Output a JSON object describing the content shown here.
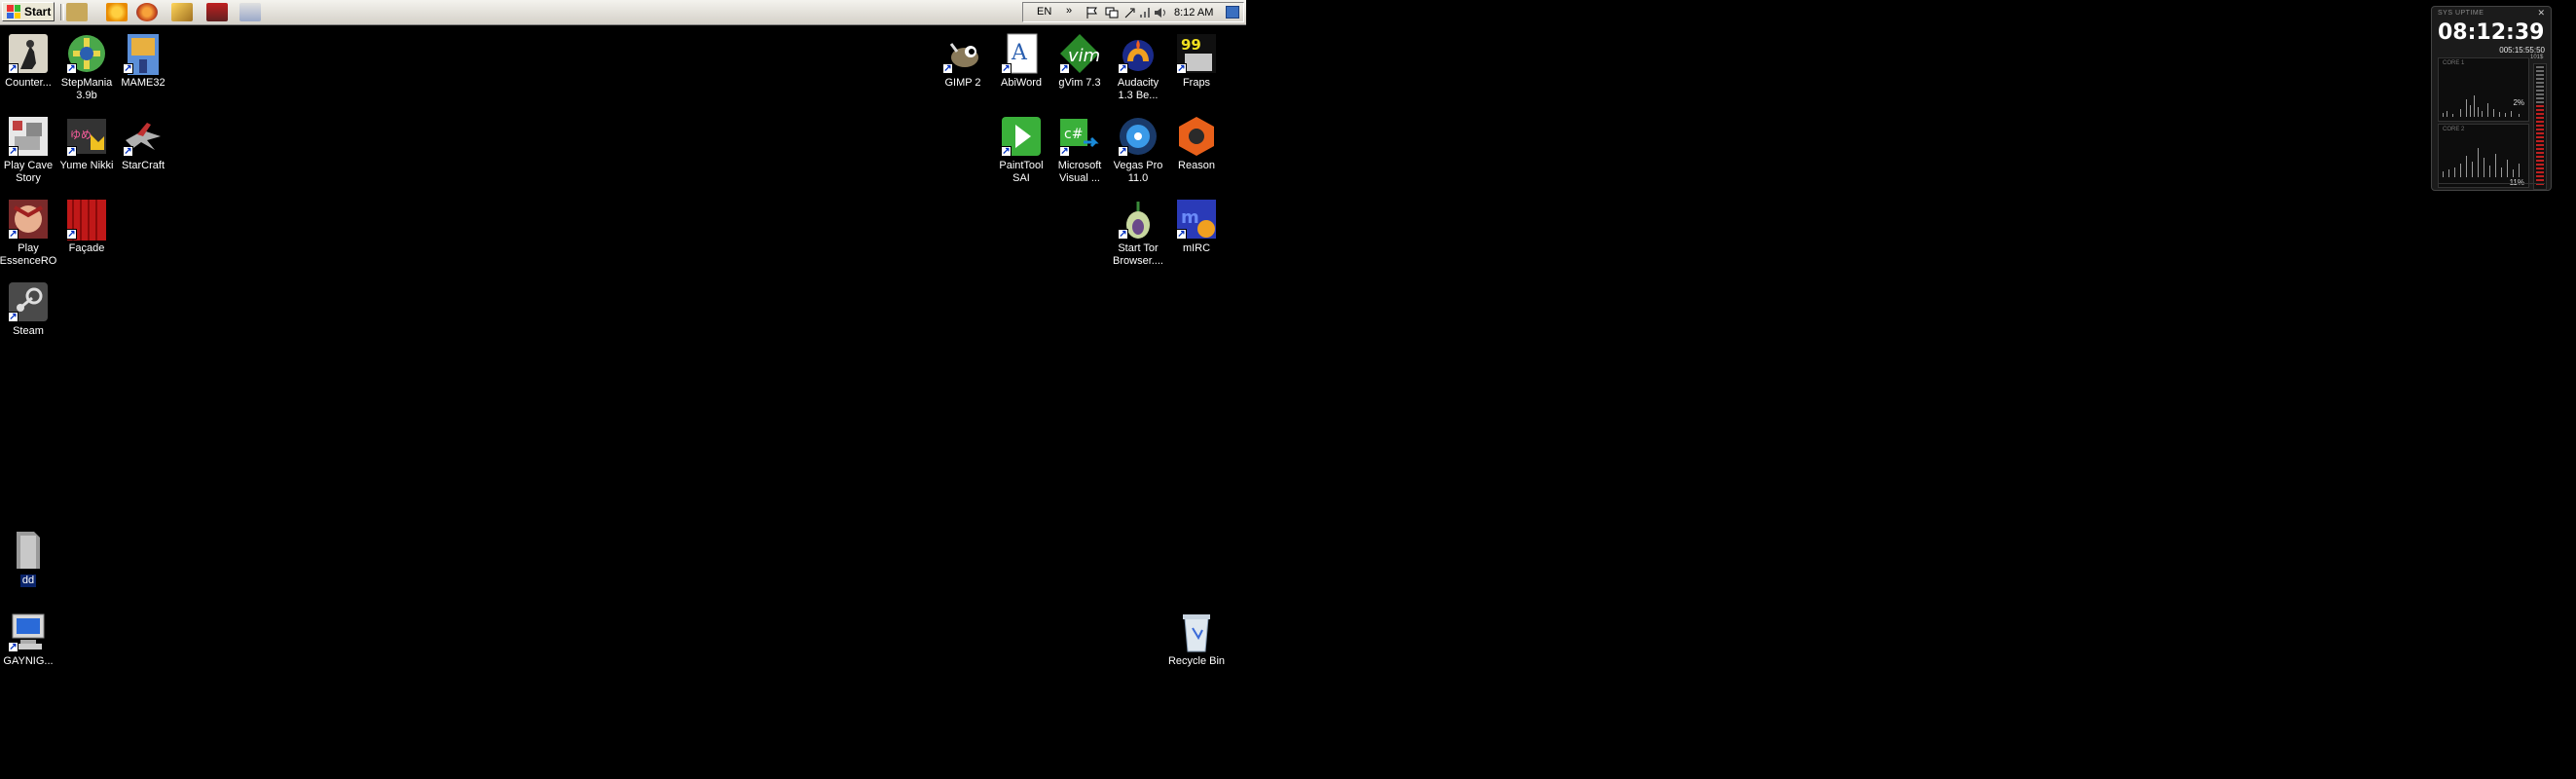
{
  "taskbar": {
    "start_label": "Start",
    "quick_launch": [
      "explorer-icon",
      "media-player-icon",
      "firefox-icon",
      "paint-icon",
      "calendar-icon",
      "show-desktop-icon"
    ],
    "tray": {
      "language": "EN",
      "clock": "8:12 AM"
    }
  },
  "desktop_left": [
    {
      "label": "Counter...",
      "icon": "counter-strike-icon"
    },
    {
      "label": "StepMania\n3.9b",
      "icon": "stepmania-icon"
    },
    {
      "label": "MAME32",
      "icon": "mame32-icon"
    },
    {
      "label": "Play Cave\nStory",
      "icon": "cave-story-icon"
    },
    {
      "label": "Yume Nikki",
      "icon": "yume-nikki-icon"
    },
    {
      "label": "StarCraft",
      "icon": "starcraft-icon"
    },
    {
      "label": "Play\nEssenceRO",
      "icon": "essencero-icon"
    },
    {
      "label": "Façade",
      "icon": "facade-icon"
    },
    {
      "label": "Steam",
      "icon": "steam-icon"
    },
    {
      "label": "dd",
      "icon": "folder-icon"
    },
    {
      "label": "GAYNIG...",
      "icon": "my-computer-icon"
    }
  ],
  "desktop_right": [
    {
      "label": "GIMP 2",
      "icon": "gimp-icon"
    },
    {
      "label": "AbiWord",
      "icon": "abiword-icon"
    },
    {
      "label": "gVim 7.3",
      "icon": "gvim-icon"
    },
    {
      "label": "Audacity\n1.3 Be...",
      "icon": "audacity-icon"
    },
    {
      "label": "Fraps",
      "icon": "fraps-icon"
    },
    {
      "label": "PaintTool\nSAI",
      "icon": "painttool-sai-icon"
    },
    {
      "label": "Microsoft\nVisual ...",
      "icon": "visual-studio-icon"
    },
    {
      "label": "Vegas Pro\n11.0",
      "icon": "vegas-pro-icon"
    },
    {
      "label": "Reason",
      "icon": "reason-icon"
    },
    {
      "label": "Start Tor\nBrowser....",
      "icon": "tor-browser-icon"
    },
    {
      "label": "mIRC",
      "icon": "mirc-icon"
    },
    {
      "label": "Recycle Bin",
      "icon": "recycle-bin-icon"
    }
  ],
  "gadget": {
    "header": "SYS UPTIME",
    "time": "08:12:39",
    "uptime": "005:15:55:50",
    "mem_label": "101$",
    "core1_label": "CORE 1",
    "core1_pct": "2%",
    "core2_label": "CORE 2",
    "core2_pct": "11%"
  }
}
